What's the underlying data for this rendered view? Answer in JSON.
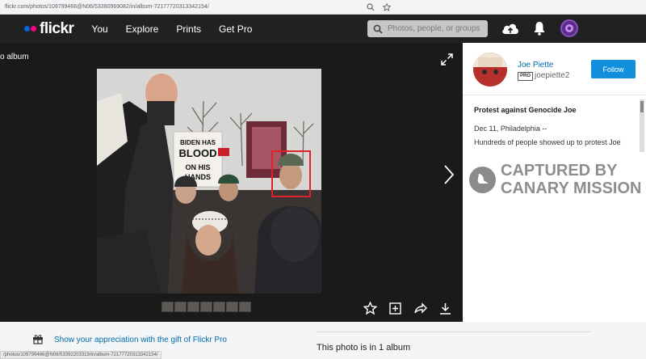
{
  "browser": {
    "url": "flickr.com/photos/109799466@N06/53390969082/in/album-72177720313342154/"
  },
  "header": {
    "logo": "flickr",
    "nav": [
      "You",
      "Explore",
      "Prints",
      "Get Pro"
    ],
    "search_placeholder": "Photos, people, or groups"
  },
  "viewer": {
    "back_label": "o album",
    "photo_signs": {
      "sign1_line1": "BIDEN HAS",
      "sign1_line2": "BLOOD",
      "sign1_line3": "ON HIS",
      "sign1_line4": "HANDS"
    },
    "thumbnail_count": 7
  },
  "side": {
    "owner_name": "Joe Piette",
    "pro_badge": "PRO",
    "owner_handle": "joepiette2",
    "follow_label": "Follow",
    "photo_title": "Protest against Genocide Joe",
    "photo_date_line": "Dec 11, Philadelphia --",
    "photo_desc_line": "Hundreds of people showed up to protest Joe"
  },
  "watermark": {
    "line1": "CAPTURED BY",
    "line2": "CANARY MISSION"
  },
  "bottom": {
    "gift_text": "Show your appreciation with the gift of Flickr Pro",
    "album_text": "This photo is in 1 album",
    "status_url": "/photos/109799466@N06/53392203319/in/album-72177720313342154/"
  },
  "colors": {
    "header_bg": "#212124",
    "brand_blue": "#0063dc",
    "brand_pink": "#ff0084",
    "follow_button": "#128fdc",
    "link": "#006dac",
    "highlight_box": "#e0202a"
  }
}
